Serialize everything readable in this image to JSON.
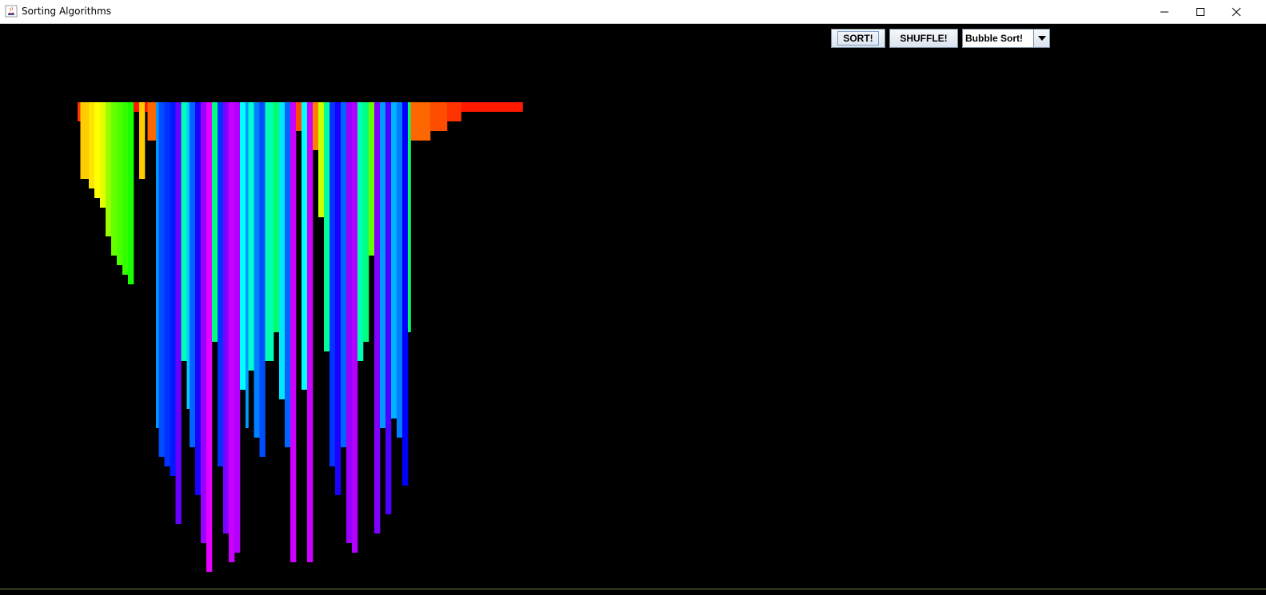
{
  "window": {
    "title": "Sorting Algorithms",
    "controls": [
      "minimize-icon",
      "maximize-icon",
      "close-icon"
    ]
  },
  "toolbar": {
    "sort_label": "SORT!",
    "shuffle_label": "SHUFFLE!",
    "algorithm_selected": "Bubble Sort!"
  },
  "visualization": {
    "background": "#000000",
    "values": [
      2,
      8,
      8,
      8,
      9,
      9,
      10,
      10,
      11,
      11,
      14,
      14,
      16,
      16,
      17,
      17,
      18,
      18,
      19,
      19,
      1,
      1,
      8,
      8,
      1,
      4,
      4,
      4,
      34,
      37,
      37,
      38,
      38,
      39,
      39,
      44,
      44,
      27,
      27,
      32,
      36,
      36,
      41,
      41,
      46,
      46,
      49,
      49,
      25,
      25,
      38,
      38,
      45,
      45,
      48,
      48,
      47,
      47,
      30,
      30,
      34,
      28,
      28,
      35,
      35,
      37,
      37,
      27,
      27,
      27,
      24,
      24,
      31,
      31,
      36,
      36,
      48,
      48,
      3,
      3,
      30,
      30,
      48,
      48,
      5,
      5,
      12,
      12,
      26,
      26,
      38,
      38,
      41,
      41,
      36,
      36,
      46,
      46,
      47,
      47,
      27,
      27,
      25,
      25,
      16,
      16,
      45,
      45,
      34,
      34,
      43,
      43,
      33,
      33,
      35,
      35,
      40,
      40,
      24,
      4,
      4,
      4,
      4,
      4,
      4,
      4,
      3,
      3,
      3,
      3,
      3,
      3,
      2,
      2,
      2,
      2,
      2,
      1,
      1,
      1,
      1,
      1,
      1,
      1,
      1,
      1,
      1,
      1,
      1,
      1,
      1,
      1,
      1,
      1,
      1,
      1,
      1,
      1,
      1
    ],
    "max_value": 50,
    "sorted_tail_start": 66
  }
}
